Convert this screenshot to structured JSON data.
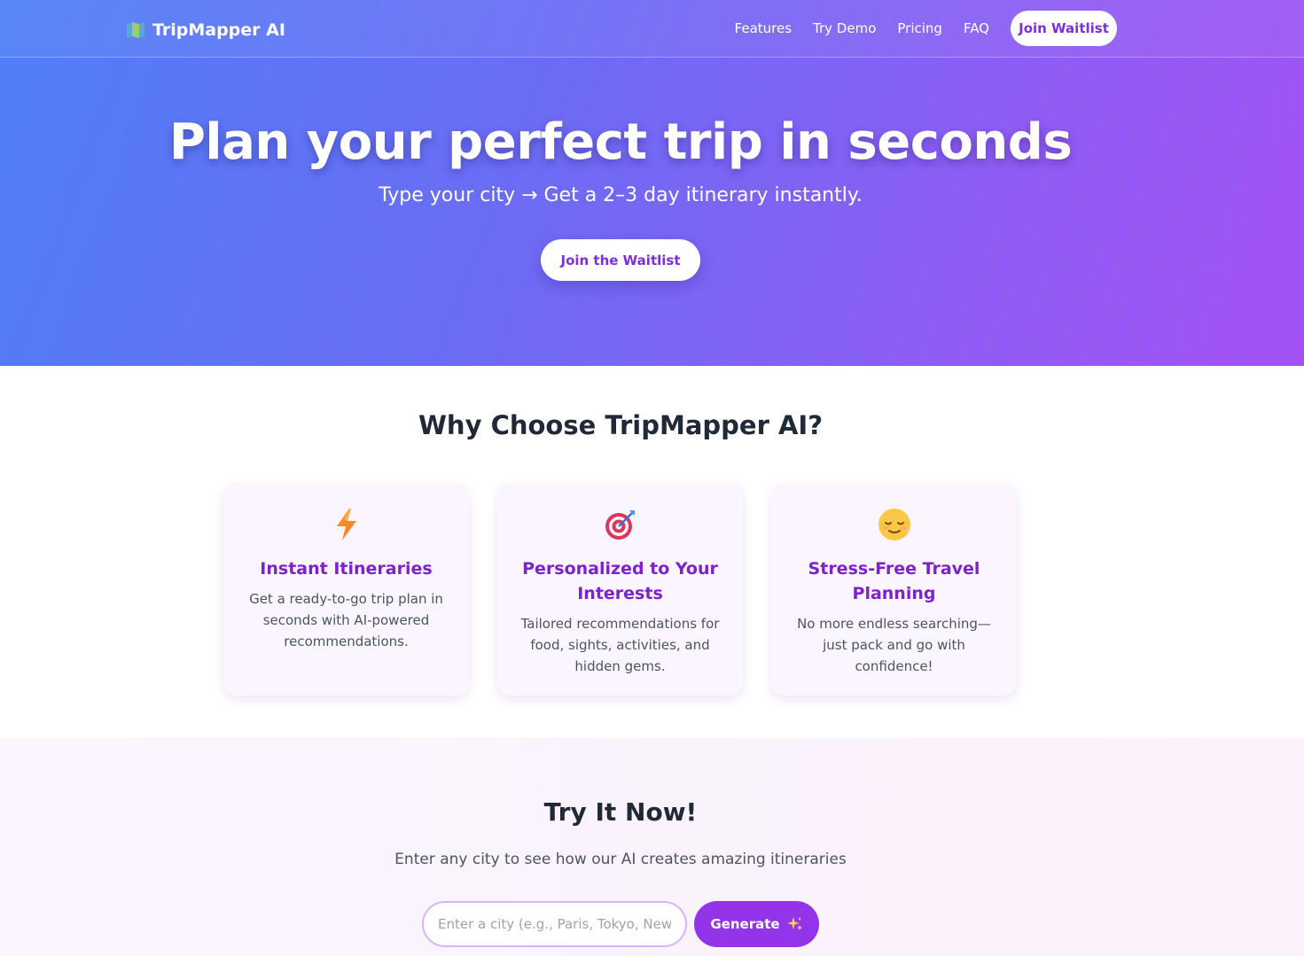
{
  "nav": {
    "brand": "TripMapper AI",
    "brand_icon": "map-icon",
    "links": [
      "Features",
      "Try Demo",
      "Pricing",
      "FAQ"
    ],
    "cta": "Join Waitlist"
  },
  "hero": {
    "title": "Plan your perfect trip in seconds",
    "subtitle": "Type your city → Get a 2–3 day itinerary instantly.",
    "cta": "Join the Waitlist"
  },
  "features": {
    "title": "Why Choose TripMapper AI?",
    "cards": [
      {
        "icon": "lightning-icon",
        "title": "Instant Itineraries",
        "text": "Get a ready-to-go trip plan in seconds with AI-powered recommendations."
      },
      {
        "icon": "target-icon",
        "title": "Personalized to Your Interests",
        "text": "Tailored recommendations for food, sights, activities, and hidden gems."
      },
      {
        "icon": "relieved-face-icon",
        "title": "Stress-Free Travel Planning",
        "text": "No more endless searching—just pack and go with confidence!"
      }
    ]
  },
  "try": {
    "title": "Try It Now!",
    "subtitle": "Enter any city to see how our AI creates amazing itineraries",
    "input_placeholder": "Enter a city (e.g., Paris, Tokyo, New York)",
    "input_value": "",
    "button": "Generate",
    "button_icon": "sparkles-icon"
  },
  "colors": {
    "accent": "#9333ea",
    "accent_text": "#7e22ce",
    "hero_gradient_start": "#4f7ff6",
    "hero_gradient_end": "#a452f3"
  }
}
